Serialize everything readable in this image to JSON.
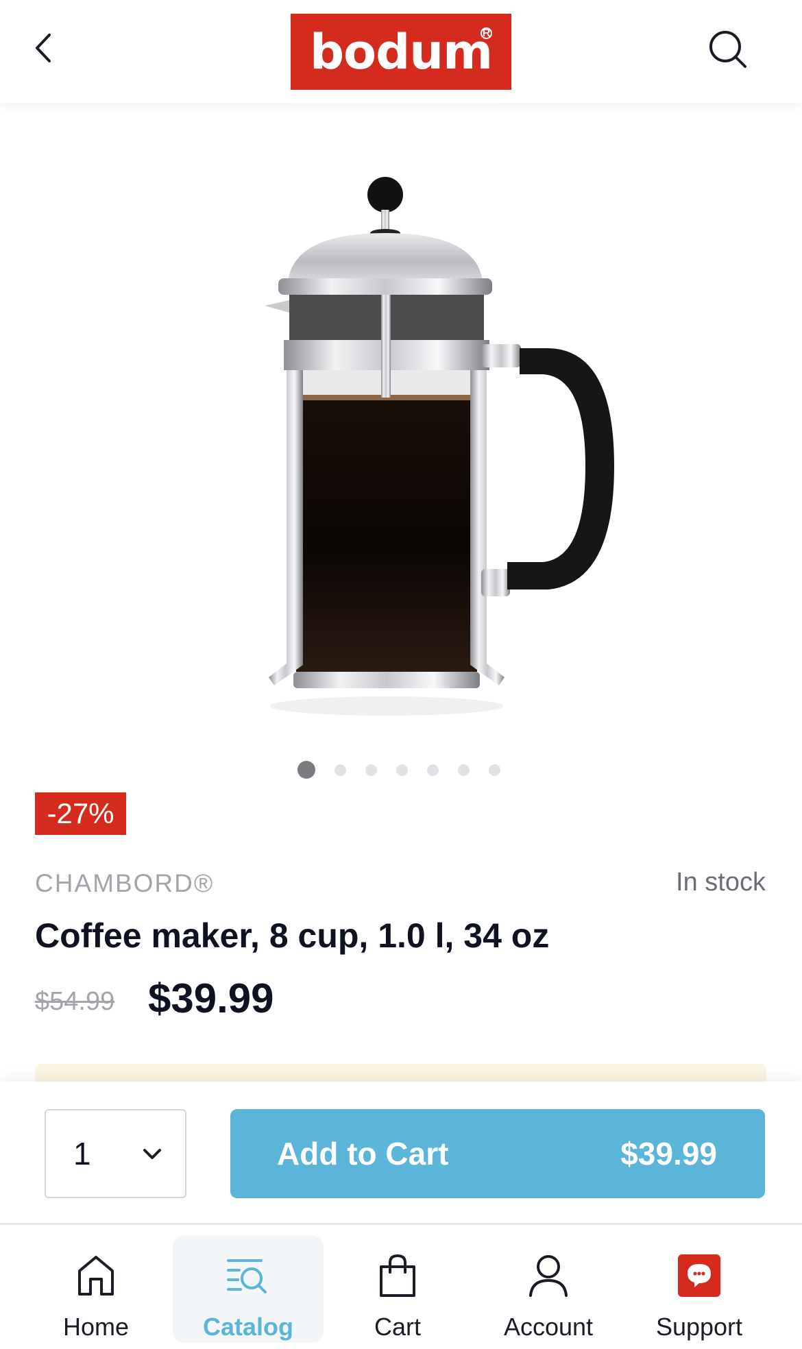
{
  "header": {
    "logo_text": "bodum",
    "logo_color": "#d52b1e"
  },
  "gallery": {
    "image_alt": "Coffee maker",
    "dot_count": 7,
    "active_index": 0
  },
  "product": {
    "discount_badge": "-27%",
    "brand": "CHAMBORD®",
    "stock_status": "In stock",
    "title": "Coffee maker, 8 cup, 1.0 l, 34 oz",
    "old_price": "$54.99",
    "price": "$39.99"
  },
  "cart_bar": {
    "quantity": "1",
    "add_label": "Add to Cart",
    "add_price": "$39.99",
    "button_color": "#5ab5d8"
  },
  "bottom_nav": {
    "items": [
      {
        "label": "Home",
        "icon": "home-icon"
      },
      {
        "label": "Catalog",
        "icon": "catalog-icon",
        "active": true
      },
      {
        "label": "Cart",
        "icon": "bag-icon"
      },
      {
        "label": "Account",
        "icon": "person-icon"
      },
      {
        "label": "Support",
        "icon": "chat-icon"
      }
    ]
  }
}
